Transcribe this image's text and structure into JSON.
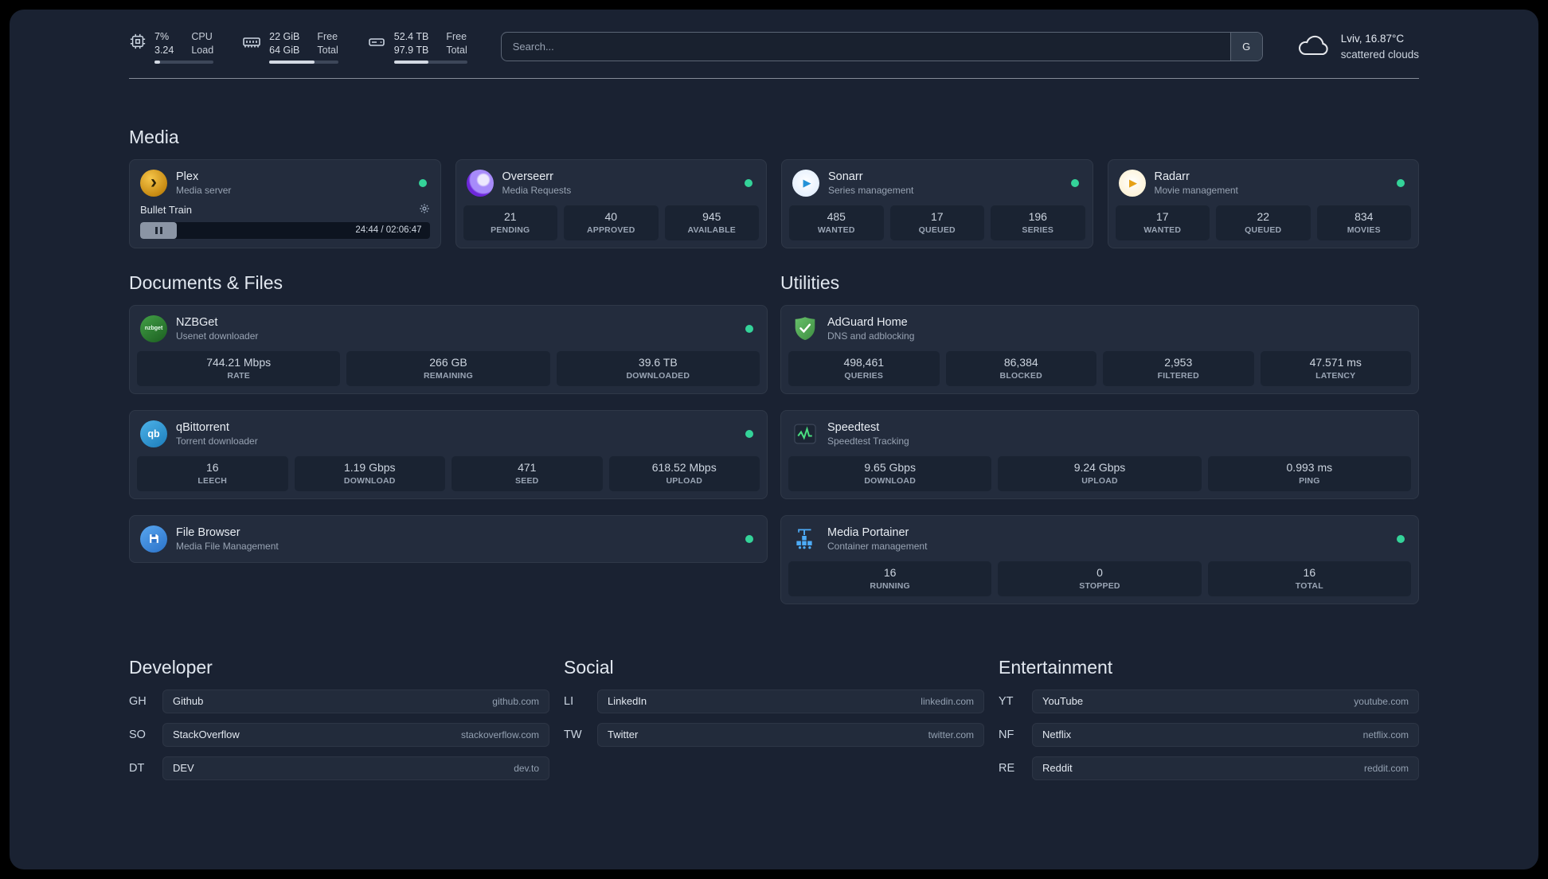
{
  "topbar": {
    "cpu": {
      "value1": "7%",
      "value2": "3.24",
      "label1": "CPU",
      "label2": "Load"
    },
    "memory": {
      "value1": "22 GiB",
      "value2": "64 GiB",
      "label1": "Free",
      "label2": "Total"
    },
    "disk": {
      "value1": "52.4 TB",
      "value2": "97.9 TB",
      "label1": "Free",
      "label2": "Total"
    },
    "search": {
      "placeholder": "Search...",
      "provider_label": "G"
    },
    "weather": {
      "location": "Lviv, 16.87°C",
      "condition": "scattered clouds"
    }
  },
  "sections": {
    "media": {
      "title": "Media"
    },
    "documents": {
      "title": "Documents & Files"
    },
    "utilities": {
      "title": "Utilities"
    },
    "developer": {
      "title": "Developer"
    },
    "social": {
      "title": "Social"
    },
    "entertainment": {
      "title": "Entertainment"
    }
  },
  "services": {
    "plex": {
      "name": "Plex",
      "subtitle": "Media server",
      "player": {
        "track": "Bullet Train",
        "time": "24:44 / 02:06:47"
      }
    },
    "overseerr": {
      "name": "Overseerr",
      "subtitle": "Media Requests",
      "stats": [
        {
          "value": "21",
          "label": "PENDING"
        },
        {
          "value": "40",
          "label": "APPROVED"
        },
        {
          "value": "945",
          "label": "AVAILABLE"
        }
      ]
    },
    "sonarr": {
      "name": "Sonarr",
      "subtitle": "Series management",
      "stats": [
        {
          "value": "485",
          "label": "WANTED"
        },
        {
          "value": "17",
          "label": "QUEUED"
        },
        {
          "value": "196",
          "label": "SERIES"
        }
      ]
    },
    "radarr": {
      "name": "Radarr",
      "subtitle": "Movie management",
      "stats": [
        {
          "value": "17",
          "label": "WANTED"
        },
        {
          "value": "22",
          "label": "QUEUED"
        },
        {
          "value": "834",
          "label": "MOVIES"
        }
      ]
    },
    "nzbget": {
      "name": "NZBGet",
      "subtitle": "Usenet downloader",
      "icon_text": "nzbget",
      "stats": [
        {
          "value": "744.21 Mbps",
          "label": "RATE"
        },
        {
          "value": "266 GB",
          "label": "REMAINING"
        },
        {
          "value": "39.6 TB",
          "label": "DOWNLOADED"
        }
      ]
    },
    "qbittorrent": {
      "name": "qBittorrent",
      "subtitle": "Torrent downloader",
      "icon_text": "qb",
      "stats": [
        {
          "value": "16",
          "label": "LEECH"
        },
        {
          "value": "1.19 Gbps",
          "label": "DOWNLOAD"
        },
        {
          "value": "471",
          "label": "SEED"
        },
        {
          "value": "618.52 Mbps",
          "label": "UPLOAD"
        }
      ]
    },
    "filebrowser": {
      "name": "File Browser",
      "subtitle": "Media File Management"
    },
    "adguard": {
      "name": "AdGuard Home",
      "subtitle": "DNS and adblocking",
      "stats": [
        {
          "value": "498,461",
          "label": "QUERIES"
        },
        {
          "value": "86,384",
          "label": "BLOCKED"
        },
        {
          "value": "2,953",
          "label": "FILTERED"
        },
        {
          "value": "47.571 ms",
          "label": "LATENCY"
        }
      ]
    },
    "speedtest": {
      "name": "Speedtest",
      "subtitle": "Speedtest Tracking",
      "stats": [
        {
          "value": "9.65 Gbps",
          "label": "DOWNLOAD"
        },
        {
          "value": "9.24 Gbps",
          "label": "UPLOAD"
        },
        {
          "value": "0.993 ms",
          "label": "PING"
        }
      ]
    },
    "portainer": {
      "name": "Media Portainer",
      "subtitle": "Container management",
      "stats": [
        {
          "value": "16",
          "label": "RUNNING"
        },
        {
          "value": "0",
          "label": "STOPPED"
        },
        {
          "value": "16",
          "label": "TOTAL"
        }
      ]
    }
  },
  "bookmarks": {
    "developer": [
      {
        "abbr": "GH",
        "name": "Github",
        "domain": "github.com"
      },
      {
        "abbr": "SO",
        "name": "StackOverflow",
        "domain": "stackoverflow.com"
      },
      {
        "abbr": "DT",
        "name": "DEV",
        "domain": "dev.to"
      }
    ],
    "social": [
      {
        "abbr": "LI",
        "name": "LinkedIn",
        "domain": "linkedin.com"
      },
      {
        "abbr": "TW",
        "name": "Twitter",
        "domain": "twitter.com"
      }
    ],
    "entertainment": [
      {
        "abbr": "YT",
        "name": "YouTube",
        "domain": "youtube.com"
      },
      {
        "abbr": "NF",
        "name": "Netflix",
        "domain": "netflix.com"
      },
      {
        "abbr": "RE",
        "name": "Reddit",
        "domain": "reddit.com"
      }
    ]
  },
  "colors": {
    "status_online": "#34d399",
    "panel_bg": "#1a2232",
    "card_bg": "#232c3d"
  }
}
